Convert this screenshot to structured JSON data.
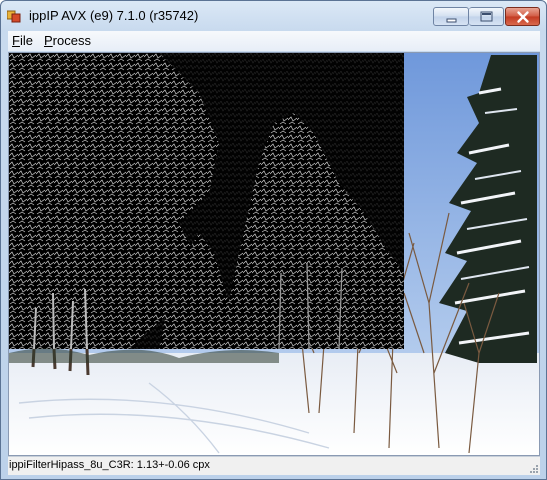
{
  "window": {
    "title": "ippIP AVX (e9) 7.1.0 (r35742)",
    "app_icon": "app-window-icon",
    "controls": {
      "minimize_icon": "minimize-icon",
      "maximize_icon": "maximize-icon",
      "close_icon": "close-icon",
      "close_color": "#c83b23"
    }
  },
  "menu": {
    "file": {
      "accel": "F",
      "rest": "ile"
    },
    "process": {
      "accel": "P",
      "rest": "rocess"
    }
  },
  "image_view": {
    "content": "winter forest photo with high-pass filtered region",
    "filtered_region_color": "#000000",
    "sky_color": "#7fa6e0",
    "snow_color": "#f2f4f8"
  },
  "status": {
    "text": "ippiFilterHipass_8u_C3R: 1.13+-0.06 cpx"
  }
}
